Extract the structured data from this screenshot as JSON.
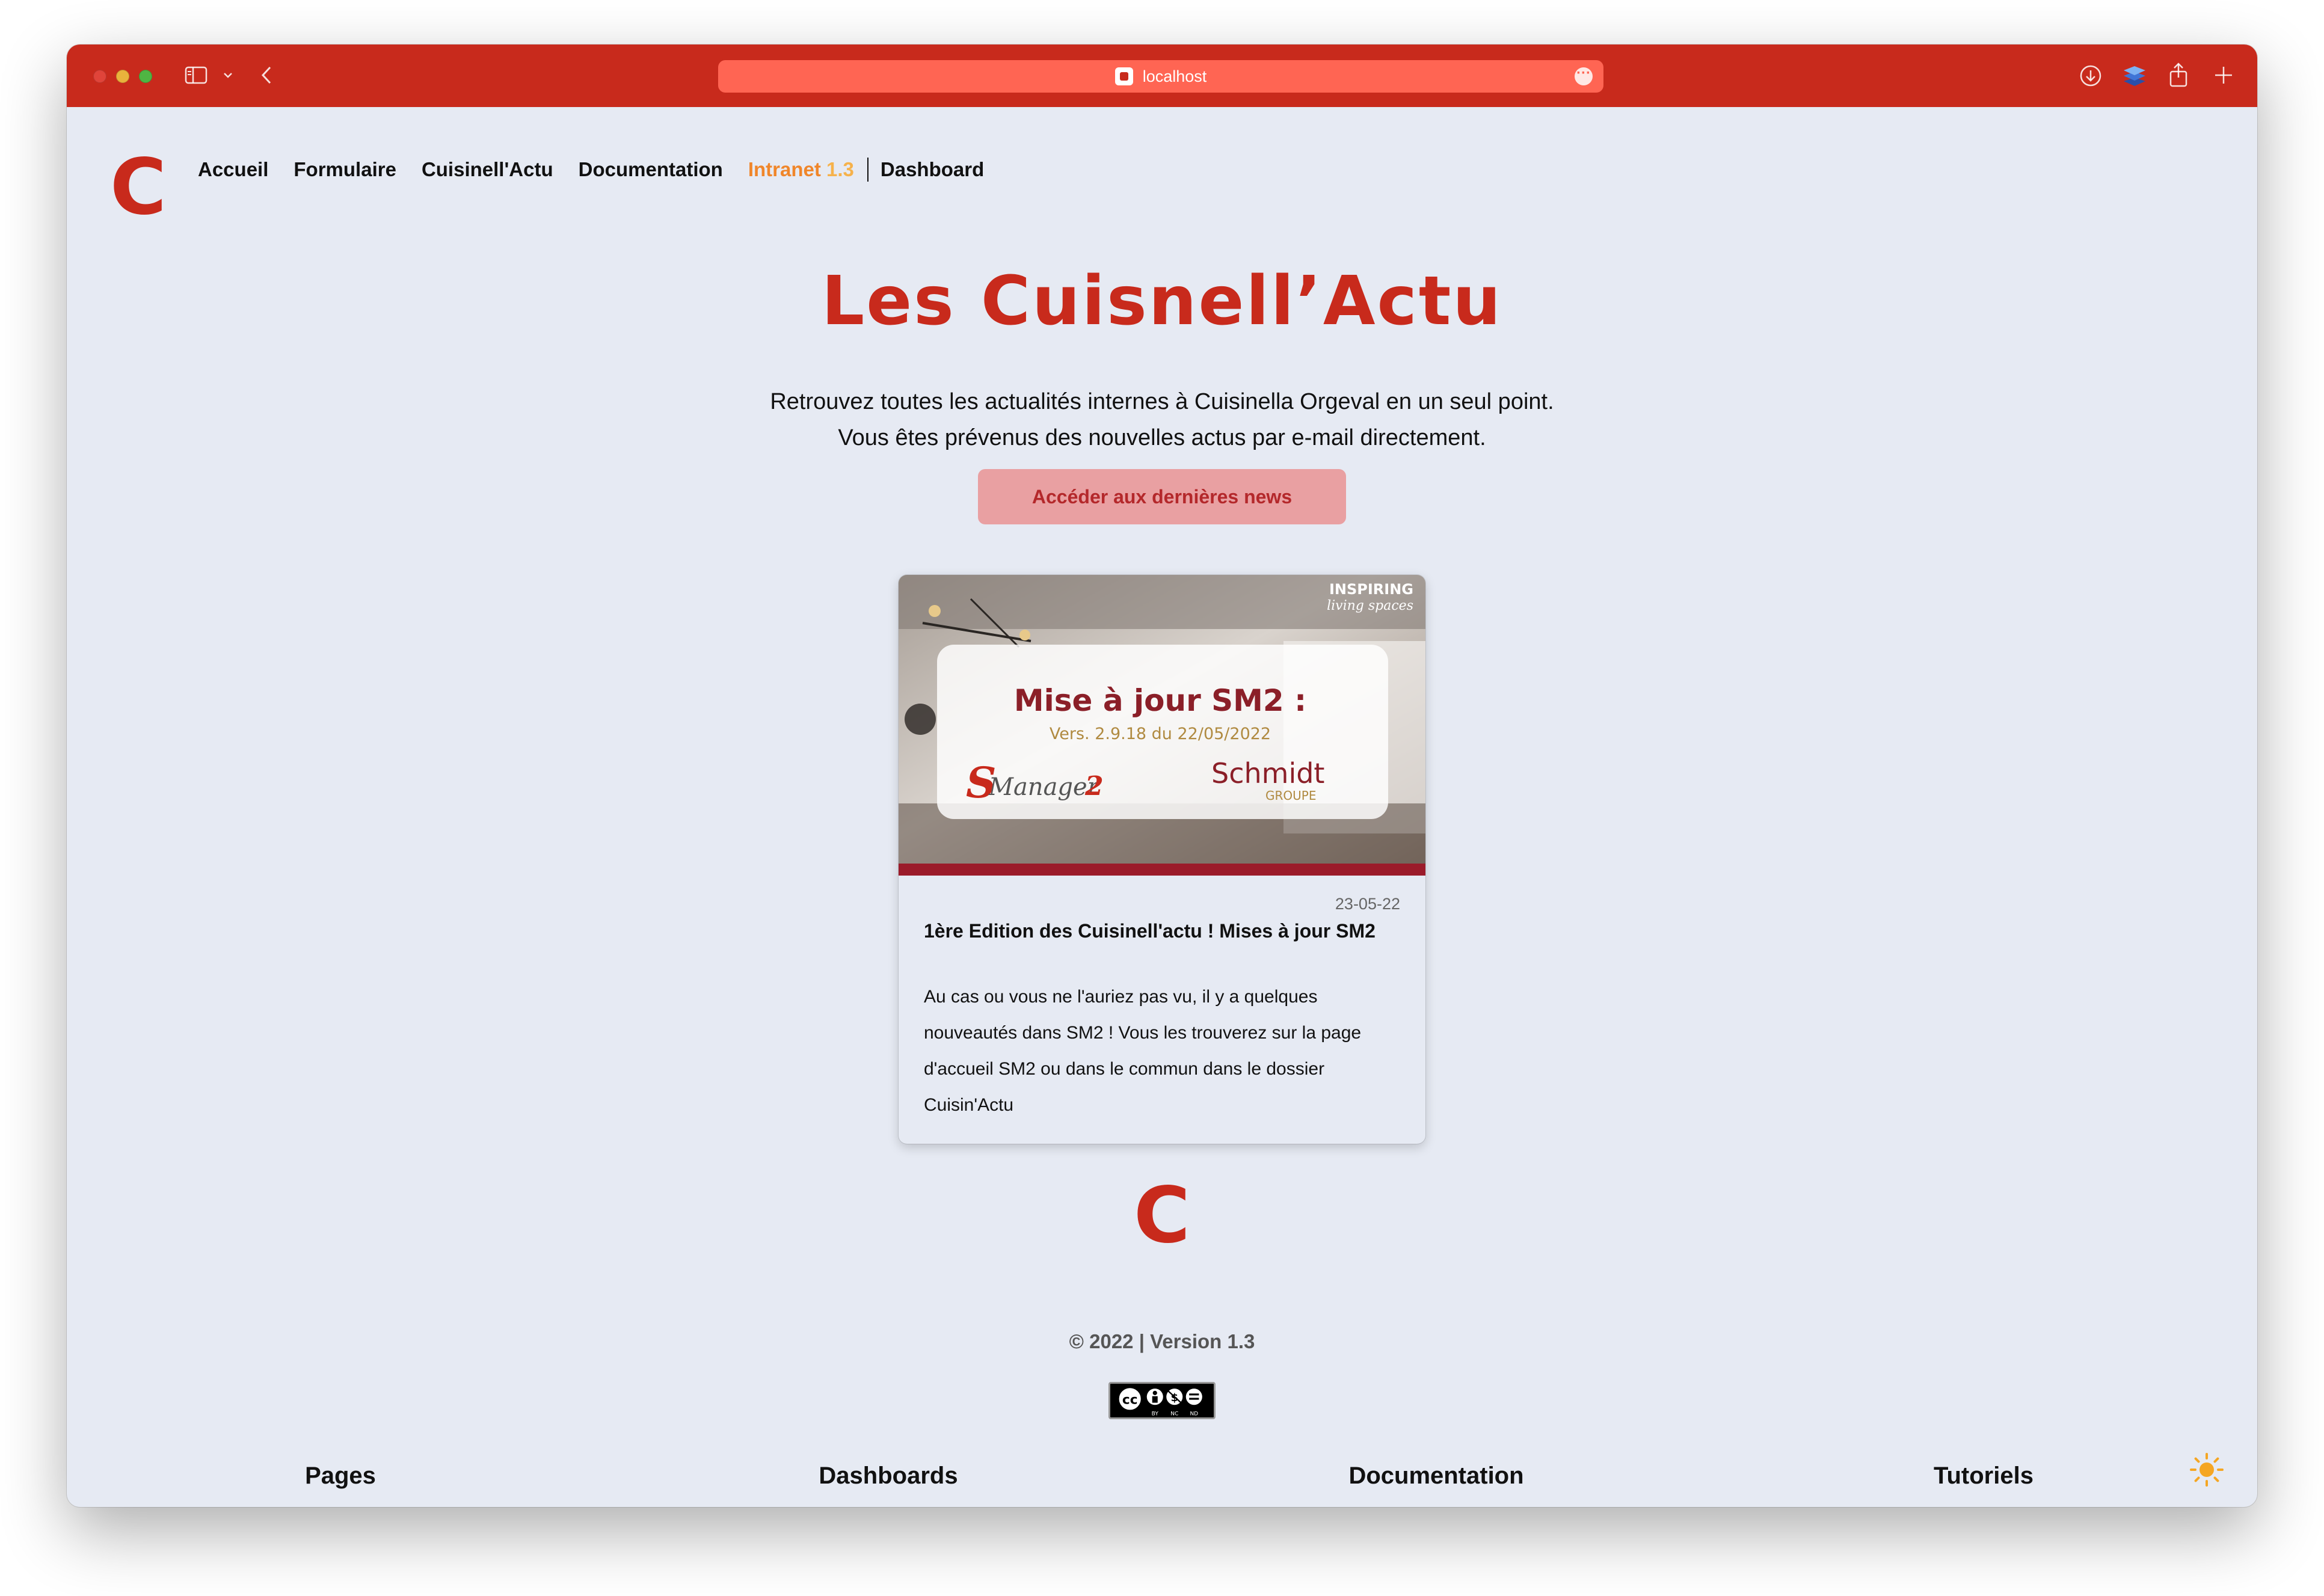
{
  "browser": {
    "url": "localhost"
  },
  "logo_letter": "C",
  "nav": {
    "items": [
      "Accueil",
      "Formulaire",
      "Cuisinell'Actu",
      "Documentation"
    ],
    "intranet": "Intranet",
    "intranet_version": "1.3",
    "dashboard": "Dashboard"
  },
  "hero": {
    "title": "Les Cuisnell’Actu",
    "line1": "Retrouvez toutes les actualités internes à Cuisinella Orgeval en un seul point.",
    "line2": "Vous êtes prévenus des nouvelles actus par e-mail directement.",
    "button": "Accéder aux dernières news"
  },
  "card": {
    "image": {
      "headline": "Mise à jour SM2 :",
      "version": "Vers. 2.9.18 du 22/05/2022",
      "brand_s": "S",
      "brand_manager": "Manager",
      "brand_2": "2",
      "brand_schmidt": "Schmidt",
      "brand_groupe": "GROUPE",
      "corner1": "INSPIRING",
      "corner2": "living spaces"
    },
    "date": "23-05-22",
    "title": "1ère Edition des Cuisinell'actu ! Mises à jour SM2",
    "text": "Au cas ou vous ne l'auriez pas vu, il y a quelques nouveautés dans SM2 ! Vous les trouverez sur la page d'accueil SM2 ou dans le commun dans le dossier Cuisin'Actu"
  },
  "footer": {
    "copyright": "© 2022 | Version 1.3",
    "license_icons": [
      "cc-icon",
      "by-icon",
      "nc-icon",
      "nd-icon"
    ],
    "license_labels": [
      "BY",
      "NC",
      "ND"
    ],
    "columns": [
      "Pages",
      "Dashboards",
      "Documentation",
      "Tutoriels"
    ]
  },
  "colors": {
    "brand_red": "#c82a1c",
    "background": "#e6eaf3",
    "accent_orange": "#f0862a",
    "button_bg": "#e9a0a2"
  }
}
